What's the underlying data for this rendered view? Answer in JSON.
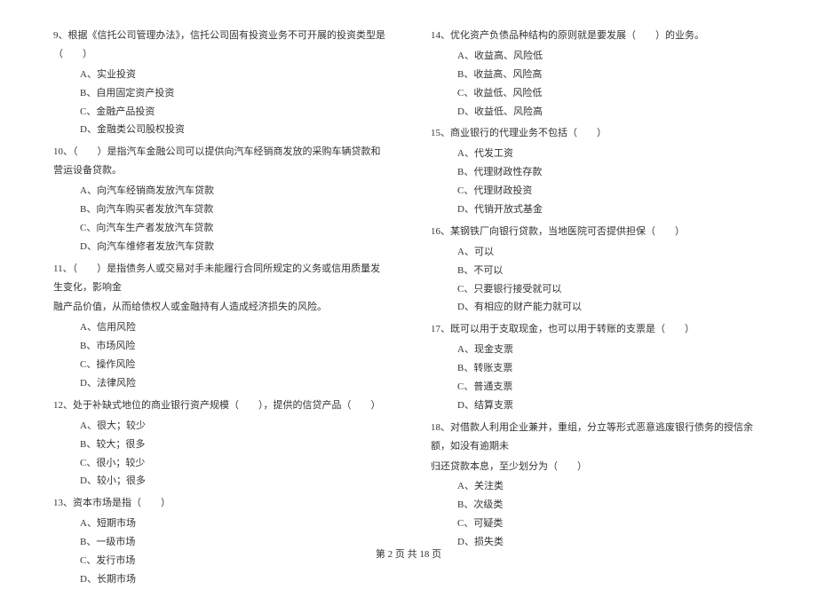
{
  "left_column": {
    "questions": [
      {
        "text": "9、根据《信托公司管理办法》，信托公司固有投资业务不可开展的投资类型是（　　）",
        "options": [
          "A、实业投资",
          "B、自用固定资产投资",
          "C、金融产品投资",
          "D、金融类公司股权投资"
        ]
      },
      {
        "text": "10、（　　）是指汽车金融公司可以提供向汽车经销商发放的采购车辆贷款和营运设备贷款。",
        "options": [
          "A、向汽车经销商发放汽车贷款",
          "B、向汽车购买者发放汽车贷款",
          "C、向汽车生产者发放汽车贷款",
          "D、向汽车维修者发放汽车贷款"
        ]
      },
      {
        "text": "11、（　　）是指债务人或交易对手未能履行合同所规定的义务或信用质量发生变化，影响金",
        "continuation": "融产品价值，从而给债权人或金融持有人造成经济损失的风险。",
        "options": [
          "A、信用风险",
          "B、市场风险",
          "C、操作风险",
          "D、法律风险"
        ]
      },
      {
        "text": "12、处于补缺式地位的商业银行资产规模（　　），提供的信贷产品（　　）",
        "options": [
          "A、很大；较少",
          "B、较大；很多",
          "C、很小；较少",
          "D、较小；很多"
        ]
      },
      {
        "text": "13、资本市场是指（　　）",
        "options": [
          "A、短期市场",
          "B、一级市场",
          "C、发行市场",
          "D、长期市场"
        ]
      }
    ]
  },
  "right_column": {
    "questions": [
      {
        "text": "14、优化资产负债品种结构的原则就是要发展（　　）的业务。",
        "options": [
          "A、收益高、风险低",
          "B、收益高、风险高",
          "C、收益低、风险低",
          "D、收益低、风险高"
        ]
      },
      {
        "text": "15、商业银行的代理业务不包括（　　）",
        "options": [
          "A、代发工资",
          "B、代理财政性存款",
          "C、代理财政投资",
          "D、代销开放式基金"
        ]
      },
      {
        "text": "16、某钢铁厂向银行贷款，当地医院可否提供担保（　　）",
        "options": [
          "A、可以",
          "B、不可以",
          "C、只要银行接受就可以",
          "D、有相应的财产能力就可以"
        ]
      },
      {
        "text": "17、既可以用于支取现金，也可以用于转账的支票是（　　）",
        "options": [
          "A、现金支票",
          "B、转账支票",
          "C、普通支票",
          "D、结算支票"
        ]
      },
      {
        "text": "18、对借款人利用企业兼并，重组，分立等形式恶意逃废银行债务的授信余额，如没有逾期未",
        "continuation": "归还贷款本息，至少划分为（　　）",
        "options": [
          "A、关注类",
          "B、次级类",
          "C、可疑类",
          "D、损失类"
        ]
      }
    ]
  },
  "footer": {
    "text": "第 2 页 共 18 页"
  }
}
